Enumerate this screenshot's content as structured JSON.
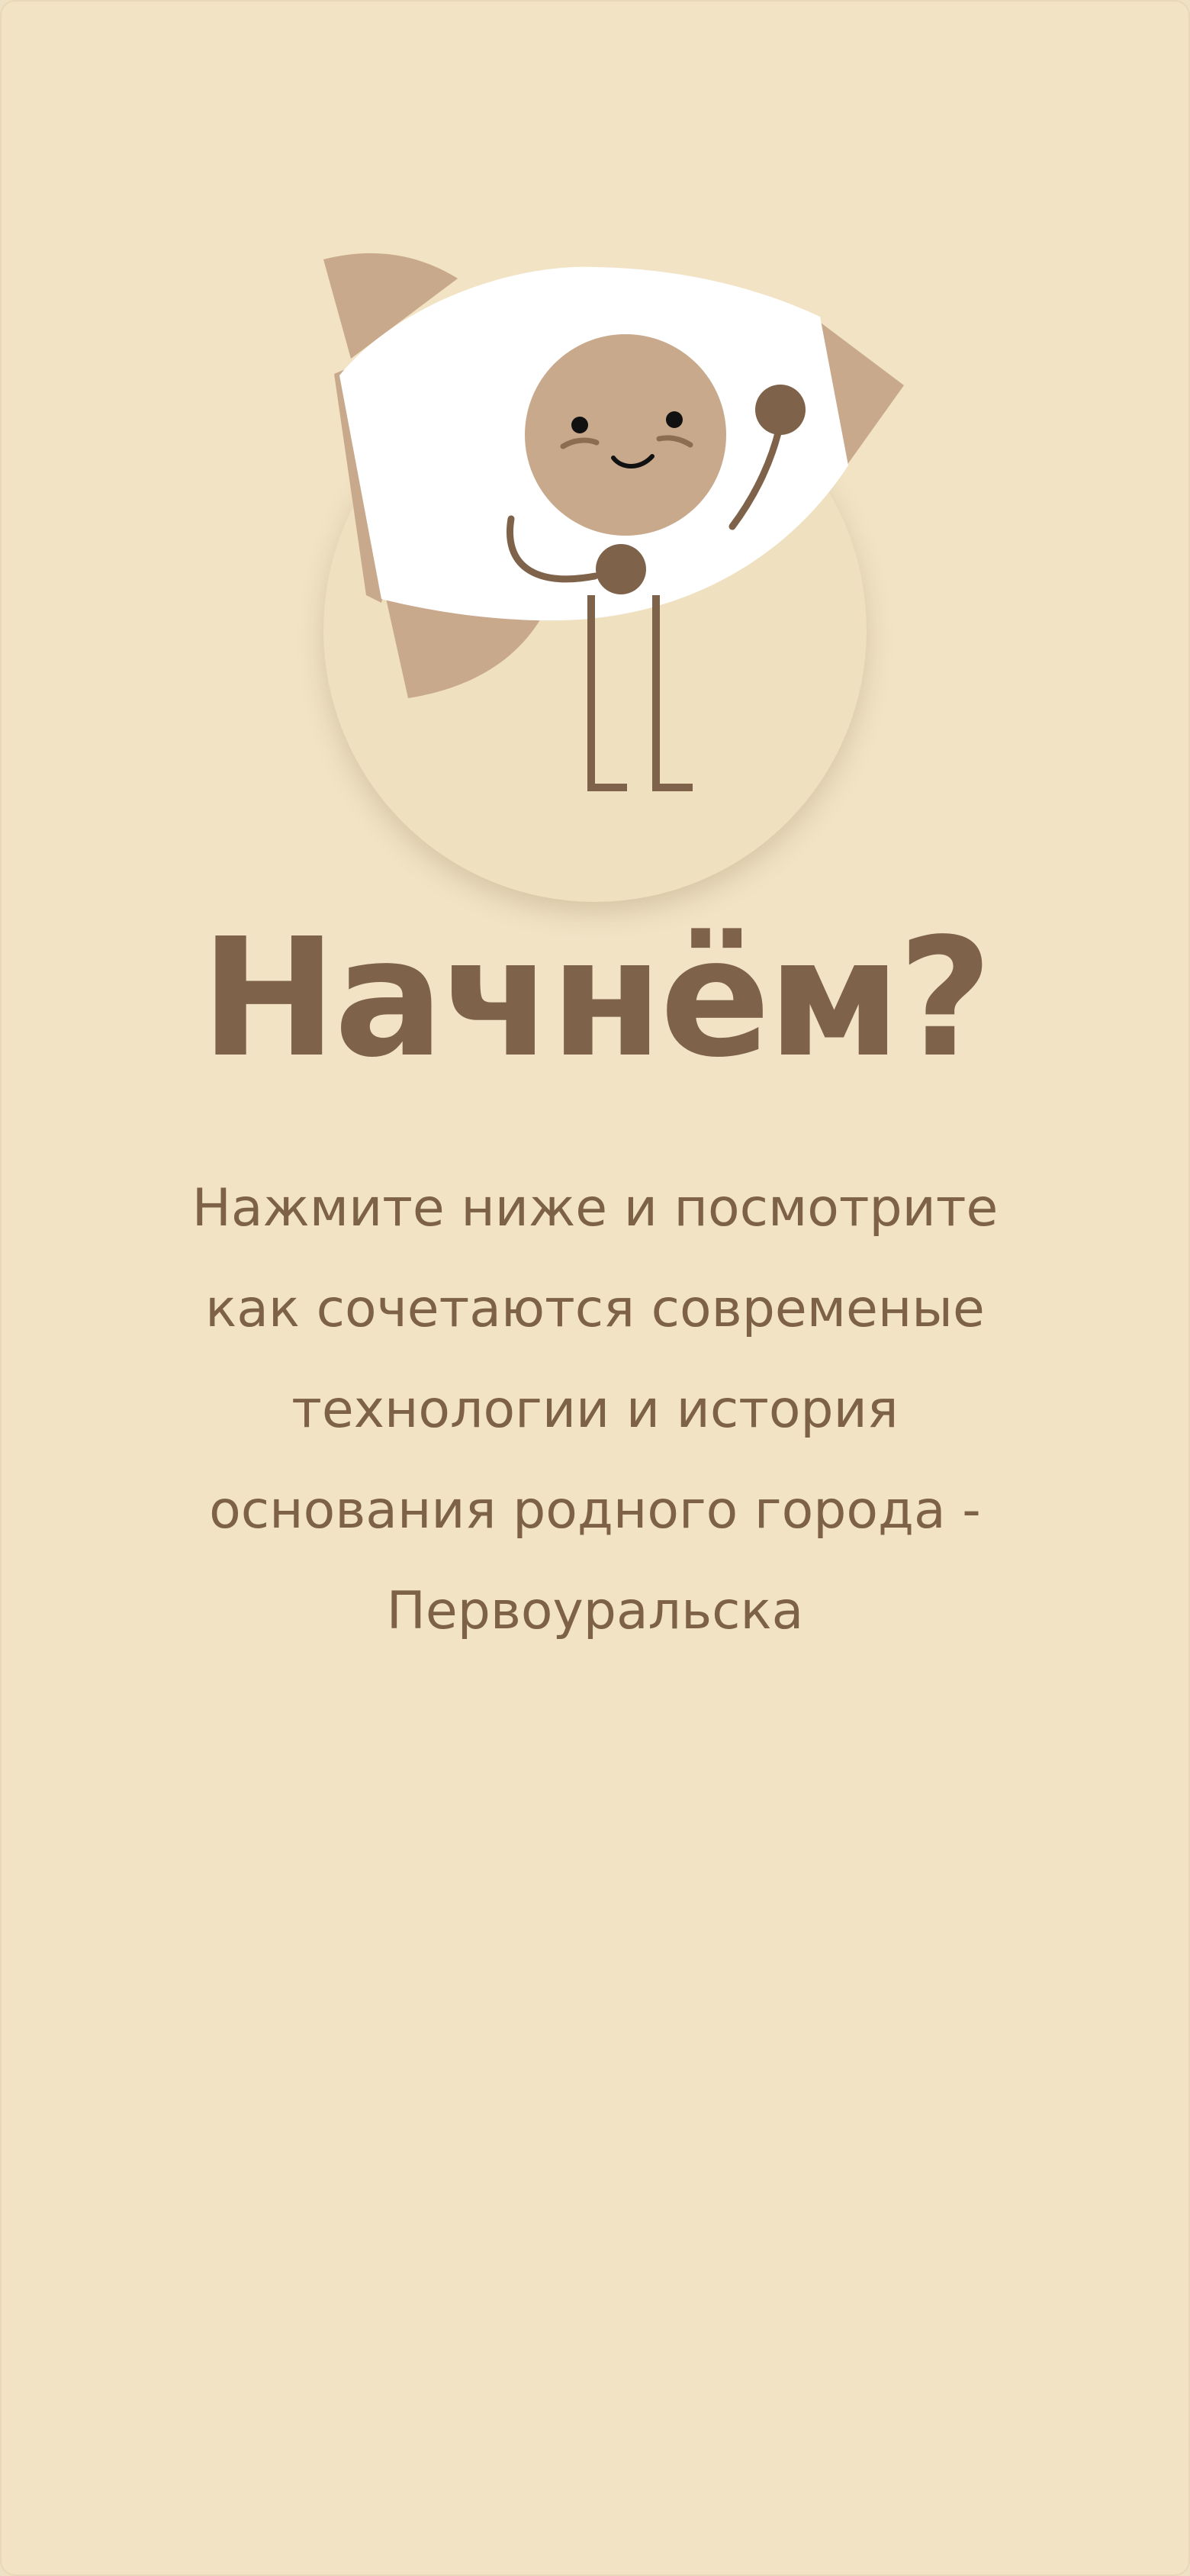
{
  "screen": {
    "title": "Начнём?",
    "description": "Нажмите ниже и посмотрите как сочетаются современые технологии и история основания родного города - Первоуральска"
  },
  "illustration": {
    "name": "rocket-mascot-icon"
  },
  "colors": {
    "background": "#f1e3c4",
    "title": "#7f624a",
    "text": "#7d6247",
    "accent_tan": "#c9a98c",
    "accent_brown": "#7f624a",
    "white": "#ffffff"
  }
}
